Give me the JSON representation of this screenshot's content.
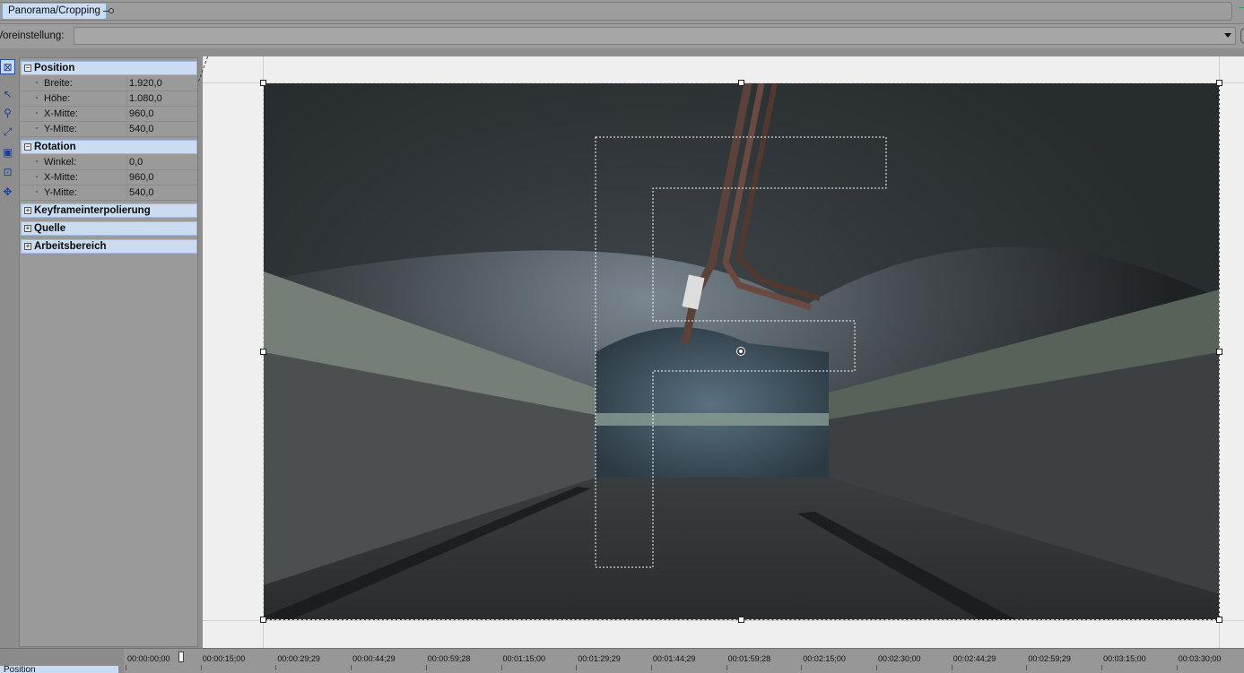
{
  "fx_chain": {
    "tab_label": "Panorama/Cropping"
  },
  "preset": {
    "label": "Voreinstellung:",
    "value": ""
  },
  "tools": [
    {
      "icon": "normal-edit-tool-icon",
      "glyph": "⊠"
    },
    {
      "icon": "pointer-tool-icon",
      "glyph": "↖"
    },
    {
      "icon": "zoom-tool-icon",
      "glyph": "⚲"
    },
    {
      "icon": "lock-aspect-tool-icon",
      "glyph": "⤢"
    },
    {
      "icon": "size-about-center-icon",
      "glyph": "▣"
    },
    {
      "icon": "fit-to-frame-icon",
      "glyph": "⊡"
    },
    {
      "icon": "move-freely-icon",
      "glyph": "✥"
    }
  ],
  "properties": {
    "position": {
      "title": "Position",
      "expanded_glyph": "−",
      "rows": [
        {
          "key": "Breite:",
          "value": "1.920,0"
        },
        {
          "key": "Höhe:",
          "value": "1.080,0"
        },
        {
          "key": "X-Mitte:",
          "value": "960,0"
        },
        {
          "key": "Y-Mitte:",
          "value": "540,0"
        }
      ]
    },
    "rotation": {
      "title": "Rotation",
      "expanded_glyph": "−",
      "rows": [
        {
          "key": "Winkel:",
          "value": "0,0"
        },
        {
          "key": "X-Mitte:",
          "value": "960,0"
        },
        {
          "key": "Y-Mitte:",
          "value": "540,0"
        }
      ]
    },
    "collapsed_sections": [
      {
        "title": "Keyframeinterpolierung",
        "glyph": "+"
      },
      {
        "title": "Quelle",
        "glyph": "+"
      },
      {
        "title": "Arbeitsbereich",
        "glyph": "+"
      }
    ]
  },
  "timeline": {
    "track_label": "Position",
    "ticks": [
      "00:00:00;00",
      "00:00:15;00",
      "00:00:29;29",
      "00:00:44;29",
      "00:00:59;28",
      "00:01:15;00",
      "00:01:29;29",
      "00:01:44;29",
      "00:01:59;28",
      "00:02:15;00",
      "00:02:30;00",
      "00:02:44;29",
      "00:02:59;29",
      "00:03:15;00",
      "00:03:30;00"
    ]
  }
}
